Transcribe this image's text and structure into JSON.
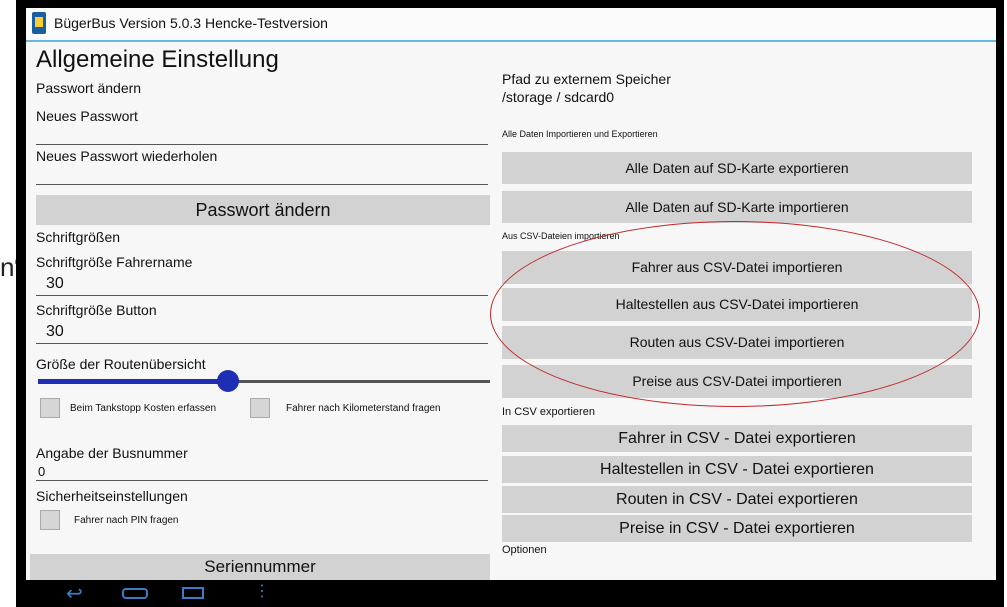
{
  "window": {
    "title": "BügerBus Version 5.0.3 Hencke-Testversion"
  },
  "left": {
    "heading": "Allgemeine Einstellung",
    "pw_change_label": "Passwort ändern",
    "new_pw_label": "Neues Passwort",
    "new_pw_repeat_label": "Neues Passwort wiederholen",
    "pw_button": "Passwort ändern",
    "font_sizes_label": "Schriftgrößen",
    "driver_font_label": "Schriftgröße Fahrername",
    "driver_font_value": "30",
    "button_font_label": "Schriftgröße Button",
    "button_font_value": "30",
    "route_overview_label": "Größe der Routenübersicht",
    "route_overview_level": 0.42,
    "cb_tank_label": "Beim Tankstopp Kosten erfassen",
    "cb_km_label": "Fahrer nach Kilometerstand fragen",
    "bus_number_label": "Angabe der Busnummer",
    "bus_number_value": "0",
    "security_label": "Sicherheitseinstellungen",
    "cb_pin_label": "Fahrer nach PIN fragen",
    "serial_button": "Seriennummer"
  },
  "right": {
    "ext_storage_label": "Pfad zu externem Speicher",
    "ext_storage_path": "/storage / sdcard0",
    "all_data_label": "Alle Daten Importieren und Exportieren",
    "export_all": "Alle Daten auf SD-Karte exportieren",
    "import_all": "Alle Daten auf SD-Karte importieren",
    "csv_import_label": "Aus CSV-Dateien importieren",
    "import_driver": "Fahrer aus CSV-Datei importieren",
    "import_stops": "Haltestellen aus CSV-Datei importieren",
    "import_routes": "Routen aus CSV-Datei importieren",
    "import_prices": "Preise aus CSV-Datei importieren",
    "csv_export_label": "In CSV exportieren",
    "export_driver": "Fahrer in CSV - Datei exportieren",
    "export_stops": "Haltestellen in CSV - Datei exportieren",
    "export_routes": "Routen in CSV - Datei exportieren",
    "export_prices": "Preise in CSV - Datei exportieren",
    "options_label": "Optionen"
  },
  "outside": {
    "fragment": "n“"
  },
  "colors": {
    "accent": "#66b8e6",
    "slider": "#1f2fb3",
    "annotation": "#c0282b"
  }
}
